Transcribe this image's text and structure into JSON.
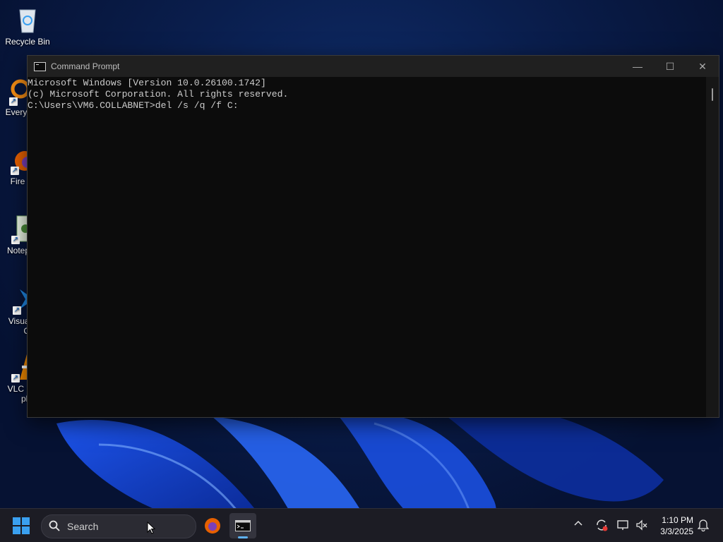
{
  "desktop": {
    "icons": [
      {
        "label": "Recycle Bin",
        "icon": "recycle-bin-icon"
      },
      {
        "label": "Every",
        "icon": "everything-icon"
      },
      {
        "label": "Fire",
        "icon": "firefox-icon"
      },
      {
        "label": "Notep",
        "icon": "notepad-icon"
      },
      {
        "label": "Visual",
        "label2": "Co",
        "icon": "vscode-icon"
      },
      {
        "label": "VLC r",
        "label2": "pla",
        "icon": "vlc-icon"
      }
    ]
  },
  "window": {
    "title": "Command Prompt",
    "controls": {
      "minimize": "—",
      "maximize": "☐",
      "close": "✕"
    },
    "console_lines": [
      "Microsoft Windows [Version 10.0.26100.1742]",
      "(c) Microsoft Corporation. All rights reserved.",
      "",
      "C:\\Users\\VM6.COLLABNET>del /s /q /f C:"
    ]
  },
  "taskbar": {
    "search_placeholder": "Search",
    "apps": [
      "firefox-icon",
      "command-prompt-icon"
    ],
    "tray": {
      "chevron": "^"
    },
    "clock": {
      "time": "1:10 PM",
      "date": "3/3/2025"
    }
  },
  "colors": {
    "accent": "#3aa0f0",
    "console_bg": "#0c0c0c",
    "console_text": "#cccccc"
  }
}
